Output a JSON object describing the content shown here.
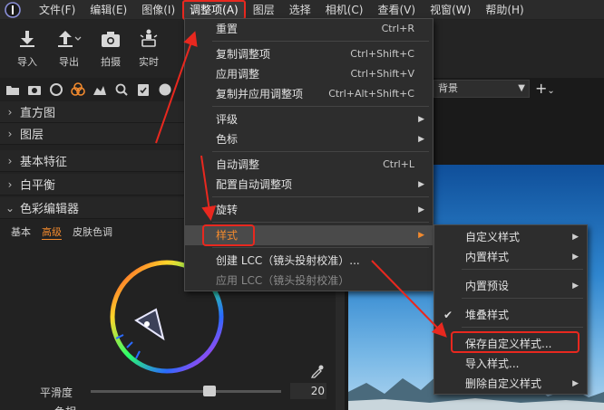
{
  "menubar": {
    "items": [
      "文件(F)",
      "编辑(E)",
      "图像(I)",
      "调整项(A)",
      "图层",
      "选择",
      "相机(C)",
      "查看(V)",
      "视窗(W)",
      "帮助(H)"
    ]
  },
  "toolbar": {
    "import": "导入",
    "export": "导出",
    "capture": "拍摄",
    "live": "实时"
  },
  "panel": {
    "sections": [
      "直方图",
      "图层",
      "基本特征",
      "白平衡",
      "色彩编辑器"
    ],
    "subtabs": [
      "基本",
      "高级",
      "皮肤色调"
    ],
    "slider_label": "平滑度",
    "slider_value": "20",
    "slider2_label": "色相"
  },
  "right": {
    "dropdown_text": "背景"
  },
  "adjust_menu": {
    "items": [
      {
        "label": "重置",
        "shortcut": "Ctrl+R"
      },
      {
        "label": "复制调整项",
        "shortcut": "Ctrl+Shift+C"
      },
      {
        "label": "应用调整",
        "shortcut": "Ctrl+Shift+V"
      },
      {
        "label": "复制并应用调整项",
        "shortcut": "Ctrl+Alt+Shift+C"
      },
      {
        "label": "评级",
        "shortcut": ""
      },
      {
        "label": "色标",
        "shortcut": ""
      },
      {
        "label": "自动调整",
        "shortcut": "Ctrl+L"
      },
      {
        "label": "配置自动调整项",
        "shortcut": ""
      },
      {
        "label": "旋转",
        "shortcut": ""
      },
      {
        "label": "样式",
        "shortcut": ""
      },
      {
        "label": "创建 LCC（镜头投射校准）...",
        "shortcut": ""
      },
      {
        "label": "应用 LCC（镜头投射校准）",
        "shortcut": ""
      }
    ]
  },
  "styles_menu": {
    "items": [
      {
        "label": "自定义样式"
      },
      {
        "label": "内置样式"
      },
      {
        "label": "内置预设"
      },
      {
        "label": "堆叠样式"
      },
      {
        "label": "保存自定义样式..."
      },
      {
        "label": "导入样式..."
      },
      {
        "label": "删除自定义样式"
      }
    ]
  },
  "colors": {
    "highlight_red": "#e8281f",
    "accent_orange": "#f28a2e"
  }
}
